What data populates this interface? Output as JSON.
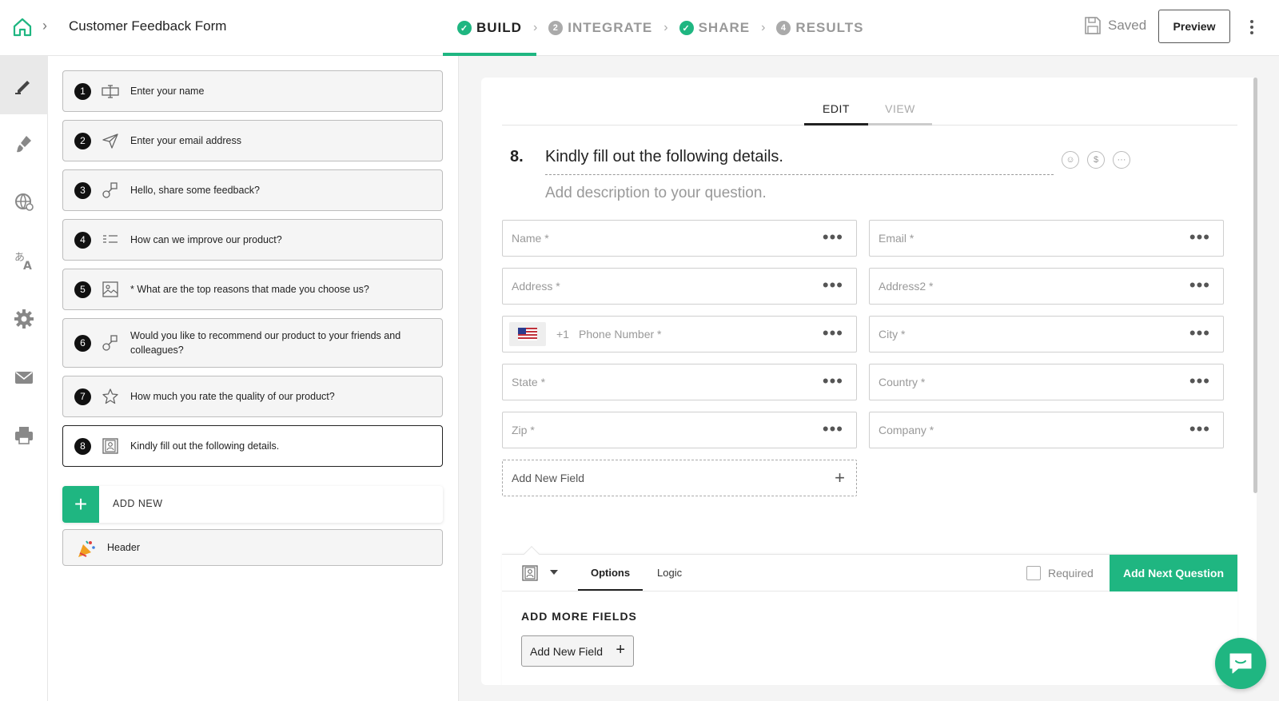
{
  "header": {
    "form_title": "Customer Feedback Form",
    "steps": [
      {
        "label": "BUILD",
        "badge": "✓",
        "state": "done-active"
      },
      {
        "label": "INTEGRATE",
        "badge": "2",
        "state": "pending"
      },
      {
        "label": "SHARE",
        "badge": "✓",
        "state": "done"
      },
      {
        "label": "RESULTS",
        "badge": "4",
        "state": "pending"
      }
    ],
    "saved_label": "Saved",
    "preview_label": "Preview"
  },
  "rail": {
    "items": [
      "pencil-icon",
      "paint-brush-icon",
      "globe-icon",
      "translate-icon",
      "gear-icon",
      "mail-icon",
      "printer-icon"
    ]
  },
  "questions": [
    {
      "num": "1",
      "icon": "text-input-icon",
      "text": "Enter your name"
    },
    {
      "num": "2",
      "icon": "send-icon",
      "text": "Enter your email address"
    },
    {
      "num": "3",
      "icon": "shapes-icon",
      "text": "Hello, share some feedback?"
    },
    {
      "num": "4",
      "icon": "list-icon",
      "text": "How can we improve our product?"
    },
    {
      "num": "5",
      "icon": "image-icon",
      "text": "* What are the top reasons that made you choose us?"
    },
    {
      "num": "6",
      "icon": "shapes-icon",
      "text": "Would you like to recommend our product to your friends and colleagues?"
    },
    {
      "num": "7",
      "icon": "star-icon",
      "text": "How much you rate the quality of our product?"
    },
    {
      "num": "8",
      "icon": "contact-card-icon",
      "text": "Kindly fill out the following details."
    }
  ],
  "add_new_label": "ADD NEW",
  "header_item_label": "Header",
  "editor": {
    "tabs": {
      "edit": "EDIT",
      "view": "VIEW"
    },
    "question_number": "8.",
    "question_title": "Kindly fill out the following details.",
    "description_placeholder": "Add description to your question.",
    "fields_left": [
      "Name *",
      "Address *",
      "Phone Number *",
      "State *",
      "Zip *"
    ],
    "fields_right": [
      "Email *",
      "Address2 *",
      "City *",
      "Country *",
      "Company *"
    ],
    "phone_code": "+1",
    "add_new_field": "Add New Field"
  },
  "options_panel": {
    "tab_options": "Options",
    "tab_logic": "Logic",
    "required_label": "Required",
    "next_button": "Add Next Question",
    "section_title": "ADD MORE FIELDS",
    "add_field_button": "Add New Field"
  },
  "colors": {
    "accent": "#1fb681"
  }
}
